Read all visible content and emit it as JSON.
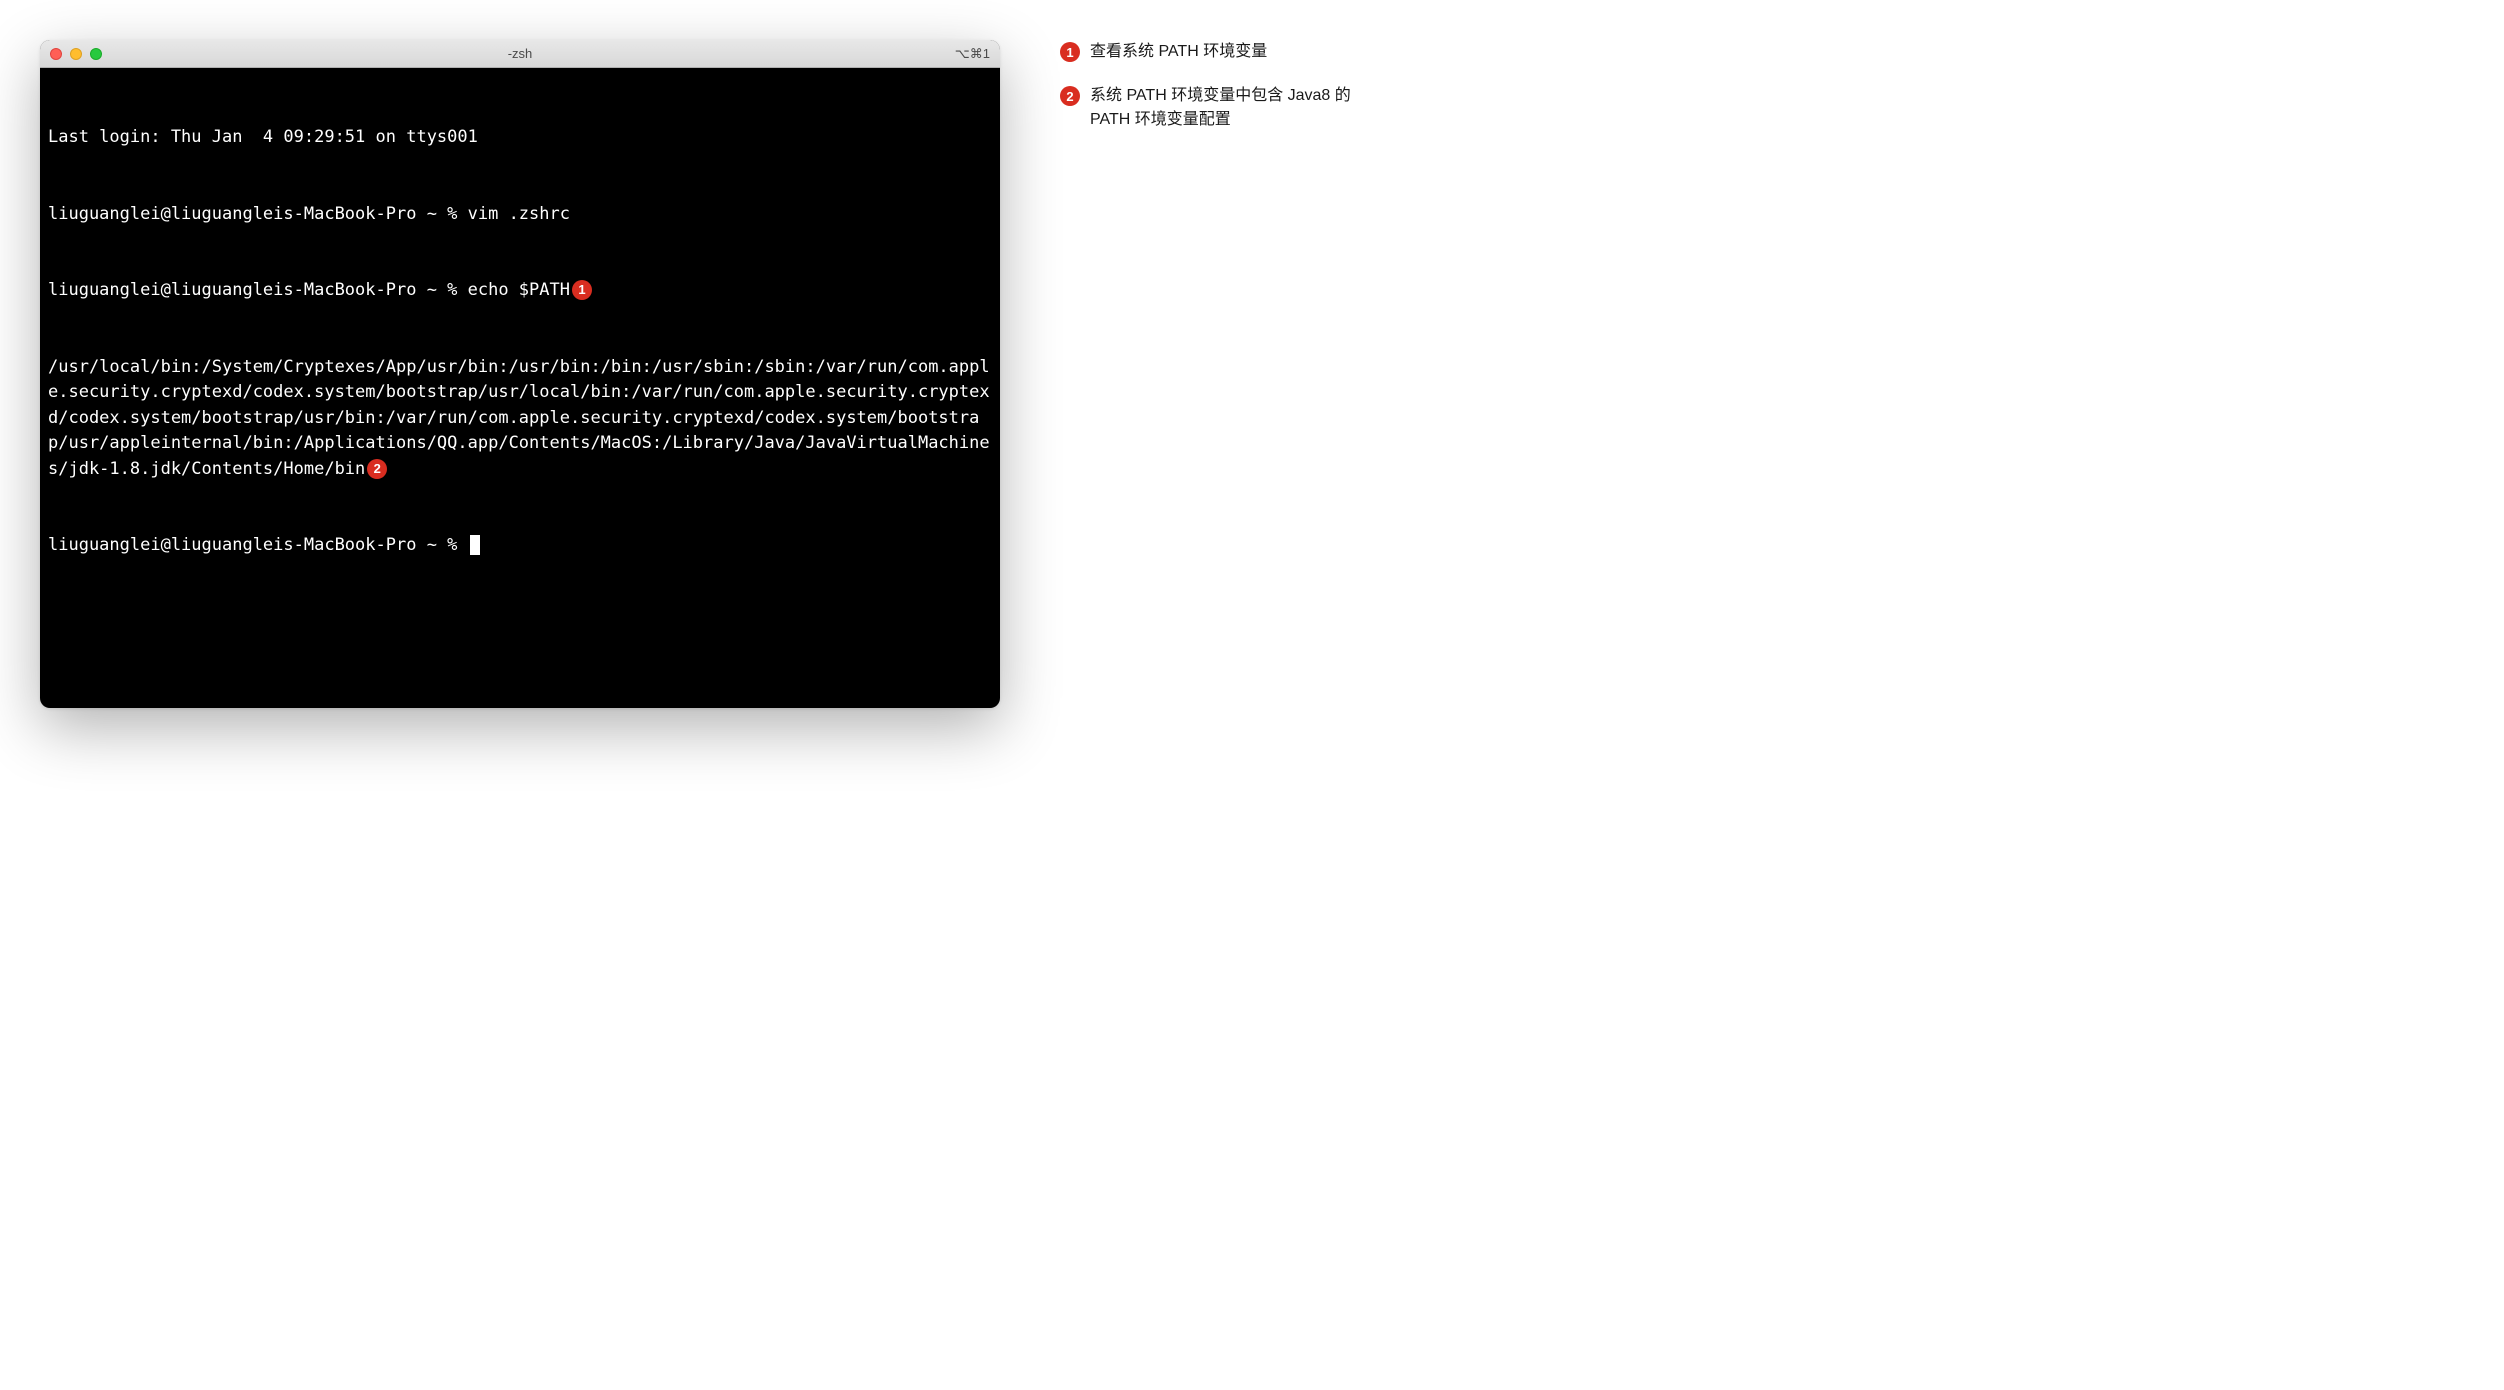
{
  "window": {
    "title": "-zsh",
    "shortcut": "⌥⌘1"
  },
  "terminal": {
    "line1": "Last login: Thu Jan  4 09:29:51 on ttys001",
    "line2": "liuguanglei@liuguangleis-MacBook-Pro ~ % vim .zshrc",
    "line3_prefix": "liuguanglei@liuguangleis-MacBook-Pro ~ % echo $PATH",
    "path_output": "/usr/local/bin:/System/Cryptexes/App/usr/bin:/usr/bin:/bin:/usr/sbin:/sbin:/var/run/com.apple.security.cryptexd/codex.system/bootstrap/usr/local/bin:/var/run/com.apple.security.cryptexd/codex.system/bootstrap/usr/bin:/var/run/com.apple.security.cryptexd/codex.system/bootstrap/usr/appleinternal/bin:/Applications/QQ.app/Contents/MacOS:/Library/Java/JavaVirtualMachines/jdk-1.8.jdk/Contents/Home/bin",
    "prompt": "liuguanglei@liuguangleis-MacBook-Pro ~ % "
  },
  "badges": {
    "badge1": "1",
    "badge2": "2"
  },
  "annotations": {
    "item1": "查看系统 PATH 环境变量",
    "item2": "系统 PATH 环境变量中包含 Java8 的PATH 环境变量配置"
  }
}
